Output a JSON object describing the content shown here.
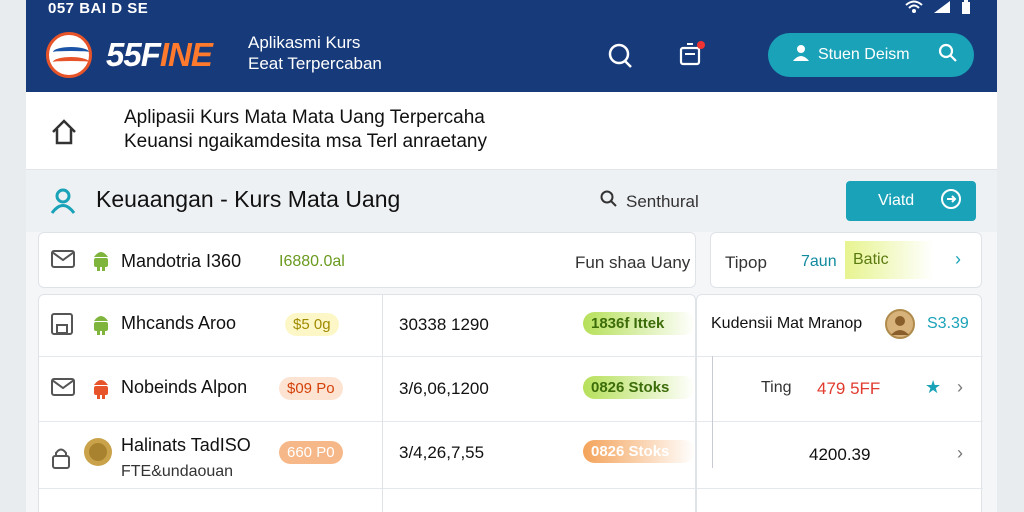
{
  "status_bar": {
    "left": "057 BAI D SE"
  },
  "header": {
    "brand_a": "55F",
    "brand_b": "INE",
    "title_line1": "Aplikasmi Kurs",
    "title_line2": "Eeat Terpercaban",
    "user_label": "Stuen Deism"
  },
  "subheader": {
    "line1": "Aplipasii Kurs Mata Mata Uang Terpercaha",
    "line2": "Keuansi ngaikamdesita msa Terl anraetany"
  },
  "section": {
    "title": "Keuaangan - Kurs Mata Uang",
    "search_label": "Senthural",
    "view_label": "Viatd"
  },
  "row1": {
    "name": "Mandotria I360",
    "value": "I6880.0al",
    "right_label": "Fun shaa Uany"
  },
  "row1_right": {
    "label": "Tipop",
    "value": "7aun",
    "badge": "Batic"
  },
  "table": {
    "rows": [
      {
        "name": "Mhcands Aroo",
        "pill": "$5 0g",
        "amount": "30338 1290",
        "change": "1836f Ittek"
      },
      {
        "name": "Nobeinds Alpon",
        "pill": "$09 Po",
        "amount": "3/6,06,1200",
        "change": "0826 Stoks"
      },
      {
        "name": "Halinats TadISO",
        "sub": "FTE&undaouan",
        "pill": "660 P0",
        "amount": "3/4,26,7,55",
        "change": "0826 Stoks"
      }
    ]
  },
  "right_panel": {
    "title": "Kudensii Mat Mranop",
    "title_value": "S3.39",
    "row2_label": "Ting",
    "row2_value": "479 5FF",
    "row3_value": "4200.39"
  },
  "colors": {
    "header_bg": "#173a7a",
    "accent": "#1aa3b8",
    "brand_orange": "#ff7a2d",
    "positive": "#b6e05a",
    "negative": "#f4a35a",
    "alert_red": "#e03b2e"
  }
}
